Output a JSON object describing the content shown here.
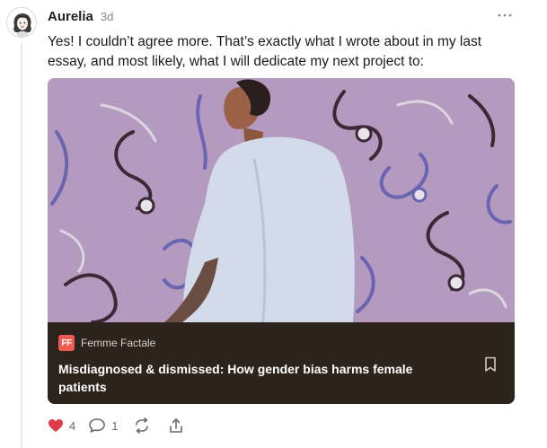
{
  "comment": {
    "author": "Aurelia",
    "time": "3d",
    "avatar_icon": "woman-portrait-avatar",
    "body": "Yes! I couldn’t agree more. That’s exactly what I wrote about in my last essay, and most likely, what I will dedicate my next project to:"
  },
  "menu": {
    "icon": "more-horizontal-icon"
  },
  "embed": {
    "publication": "Femme Factale",
    "publication_logo": "FF",
    "title": "Misdiagnosed & dismissed: How gender bias harms female patients",
    "bookmark_icon": "bookmark-icon",
    "image_description_colors": {
      "background": "#b49abe",
      "card": "#2d231d",
      "logo": "#ef5a52"
    }
  },
  "actions": {
    "likes": "4",
    "replies": "1",
    "like_icon": "heart-icon",
    "reply_icon": "comment-icon",
    "restack_icon": "restack-icon",
    "share_icon": "share-icon",
    "like_color": "#e03a4a"
  }
}
